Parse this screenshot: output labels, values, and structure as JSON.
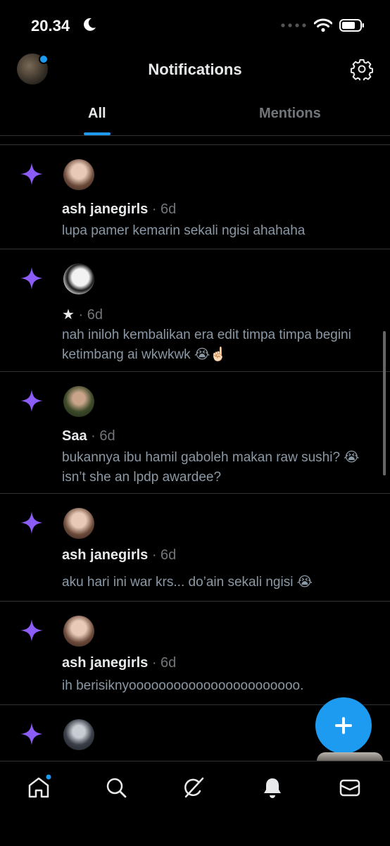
{
  "status_bar": {
    "time": "20.34"
  },
  "header": {
    "title": "Notifications"
  },
  "tabs": [
    {
      "label": "All"
    },
    {
      "label": "Mentions"
    }
  ],
  "colors": {
    "accent": "#1d9bf0",
    "star": "#8b5cf6",
    "background": "#000000",
    "muted": "#71767b"
  },
  "notifications": [
    {
      "name": "ash janegirls",
      "time": "· 6d",
      "text": "lupa pamer kemarin sekali ngisi ahahaha"
    },
    {
      "name": "★",
      "time": "· 6d",
      "text": "nah iniloh kembalikan era edit timpa timpa begini ketimbang ai wkwkwk 😭☝🏻"
    },
    {
      "name": "Saa",
      "time": "· 6d",
      "text": "bukannya ibu hamil gaboleh makan raw sushi? 😭 isn’t she an lpdp awardee?"
    },
    {
      "name": "ash janegirls",
      "time": "· 6d",
      "text": "aku hari ini war krs... do’ain sekali ngisi 😭"
    },
    {
      "name": "ash janegirls",
      "time": "· 6d",
      "text": "ih berisiknyooooooooooooooooooooooo."
    }
  ],
  "icons": {
    "nav": [
      "home-icon",
      "search-icon",
      "grok-icon",
      "notifications-icon",
      "messages-icon"
    ],
    "notification_type": "sparkle-icon",
    "fab": "compose-plus-icon",
    "settings": "gear-icon"
  }
}
